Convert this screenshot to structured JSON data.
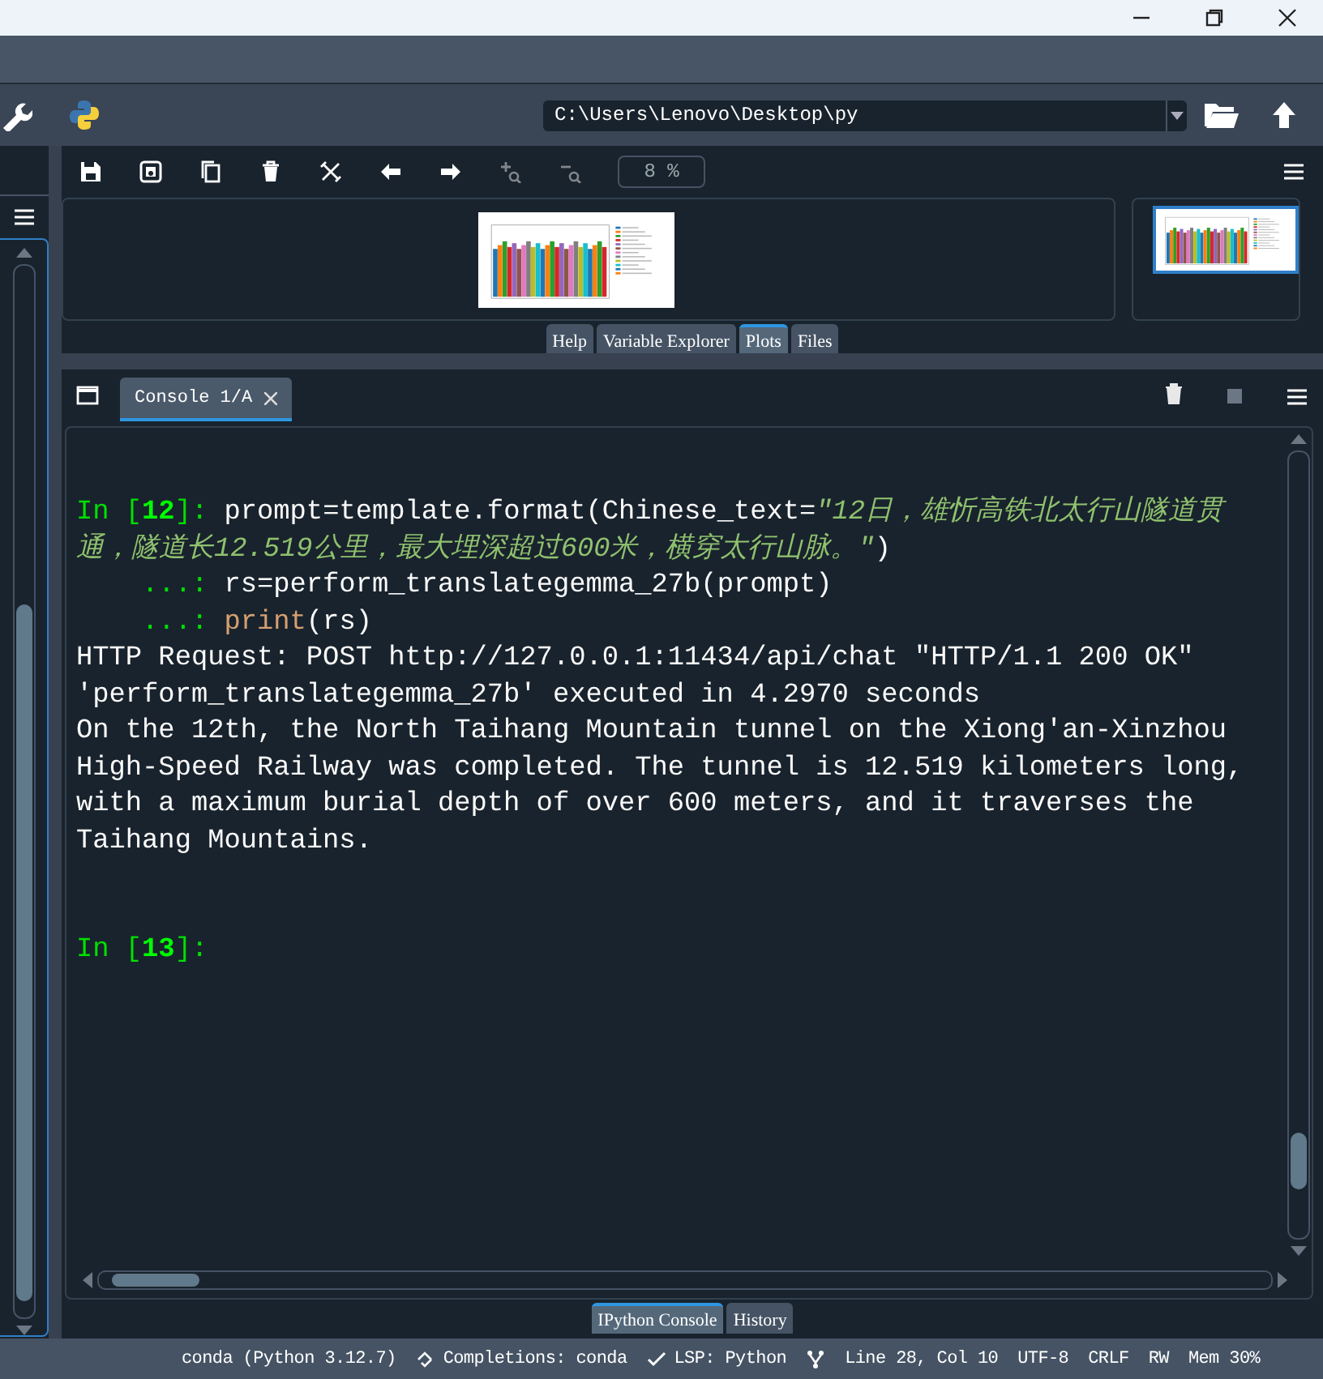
{
  "main_toolbar": {
    "path": "C:\\Users\\Lenovo\\Desktop\\py"
  },
  "plots": {
    "toolbar": [
      {
        "kind": "save",
        "disabled": false
      },
      {
        "kind": "save_all",
        "disabled": false
      },
      {
        "kind": "copy",
        "disabled": false
      },
      {
        "kind": "delete",
        "disabled": false
      },
      {
        "kind": "close_all",
        "disabled": false
      },
      {
        "kind": "back",
        "disabled": false
      },
      {
        "kind": "forward",
        "disabled": false
      },
      {
        "kind": "zoom_in",
        "disabled": true
      },
      {
        "kind": "zoom_out",
        "disabled": true
      }
    ],
    "zoom": "8 %",
    "tabs": [
      {
        "label": "Help",
        "selected": false
      },
      {
        "label": "Variable Explorer",
        "selected": false
      },
      {
        "label": "Plots",
        "selected": true
      },
      {
        "label": "Files",
        "selected": false
      }
    ]
  },
  "console": {
    "tabs": [
      {
        "label": "Console 1/A",
        "selected": true
      }
    ],
    "lines": [
      {
        "segments": [
          {
            "kind": "prompt",
            "text": "In ["
          },
          {
            "kind": "prompt_number",
            "text": "12"
          },
          {
            "kind": "prompt",
            "text": "]: "
          },
          {
            "kind": "code",
            "text": "prompt=template.format(Chinese_text="
          },
          {
            "kind": "string",
            "text": "\"12日，雄忻高铁北太行山隧道贯"
          }
        ]
      },
      {
        "segments": [
          {
            "kind": "string",
            "text": "通，隧道长12.519公里，最大埋深超过600米，横穿太行山脉。\""
          },
          {
            "kind": "code",
            "text": ")"
          }
        ]
      },
      {
        "segments": [
          {
            "kind": "prompt",
            "text": "    ...: "
          },
          {
            "kind": "code",
            "text": "rs=perform_translategemma_27b(prompt)"
          }
        ]
      },
      {
        "segments": [
          {
            "kind": "prompt",
            "text": "    ...: "
          },
          {
            "kind": "builtin",
            "text": "print"
          },
          {
            "kind": "code",
            "text": "(rs)"
          }
        ]
      },
      {
        "segments": [
          {
            "kind": "output",
            "text": "HTTP Request: POST http://127.0.0.1:11434/api/chat \"HTTP/1.1 200 OK\""
          }
        ]
      },
      {
        "segments": [
          {
            "kind": "output",
            "text": "'perform_translategemma_27b' executed in 4.2970 seconds"
          }
        ]
      },
      {
        "segments": [
          {
            "kind": "output",
            "text": "On the 12th, the North Taihang Mountain tunnel on the Xiong'an-Xinzhou"
          }
        ]
      },
      {
        "segments": [
          {
            "kind": "output",
            "text": "High-Speed Railway was completed. The tunnel is 12.519 kilometers long,"
          }
        ]
      },
      {
        "segments": [
          {
            "kind": "output",
            "text": "with a maximum burial depth of over 600 meters, and it traverses the"
          }
        ]
      },
      {
        "segments": [
          {
            "kind": "output",
            "text": "Taihang Mountains."
          }
        ]
      },
      {
        "kind": "input",
        "segments": [
          {
            "kind": "prompt",
            "text": "In ["
          },
          {
            "kind": "prompt_number",
            "text": "13"
          },
          {
            "kind": "prompt",
            "text": "]:"
          }
        ]
      }
    ],
    "pane_tabs": [
      {
        "label": "IPython Console",
        "selected": true
      },
      {
        "label": "History",
        "selected": false
      }
    ]
  },
  "status_bar": [
    {
      "kind": "env",
      "text": "conda (Python 3.12.7)"
    },
    {
      "kind": "completions",
      "text": "Completions: conda"
    },
    {
      "kind": "lsp",
      "text": "LSP: Python"
    },
    {
      "kind": "vcs"
    },
    {
      "kind": "text",
      "text": "Line 28, Col 10"
    },
    {
      "kind": "text",
      "text": "UTF-8"
    },
    {
      "kind": "text",
      "text": "CRLF"
    },
    {
      "kind": "text",
      "text": "RW"
    },
    {
      "kind": "text",
      "text": "Mem 30%"
    }
  ]
}
